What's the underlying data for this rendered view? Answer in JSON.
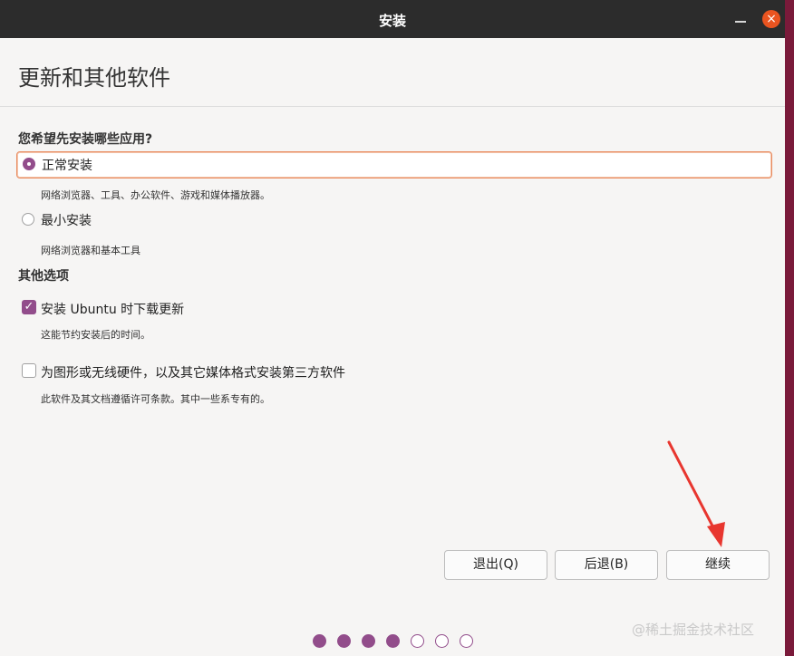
{
  "window": {
    "title": "安装",
    "minimize_icon": "minimize-icon",
    "close_icon": "×"
  },
  "page": {
    "title": "更新和其他软件"
  },
  "install_type": {
    "heading": "您希望先安装哪些应用?",
    "options": [
      {
        "label": "正常安装",
        "description": "网络浏览器、工具、办公软件、游戏和媒体播放器。",
        "selected": true
      },
      {
        "label": "最小安装",
        "description": "网络浏览器和基本工具",
        "selected": false
      }
    ]
  },
  "other_options": {
    "heading": "其他选项",
    "items": [
      {
        "label": "安装 Ubuntu 时下载更新",
        "description": "这能节约安装后的时间。",
        "checked": true
      },
      {
        "label": "为图形或无线硬件，以及其它媒体格式安装第三方软件",
        "description": "此软件及其文档遵循许可条款。其中一些系专有的。",
        "checked": false
      }
    ]
  },
  "buttons": {
    "quit": "退出(Q)",
    "back": "后退(B)",
    "continue": "继续"
  },
  "progress": {
    "current_step": 4,
    "total_steps": 7
  },
  "watermark": "@稀土掘金技术社区",
  "colors": {
    "accent": "#924d8b",
    "close": "#e95420",
    "focus_border": "#e98a5d",
    "arrow": "#e8362f"
  }
}
